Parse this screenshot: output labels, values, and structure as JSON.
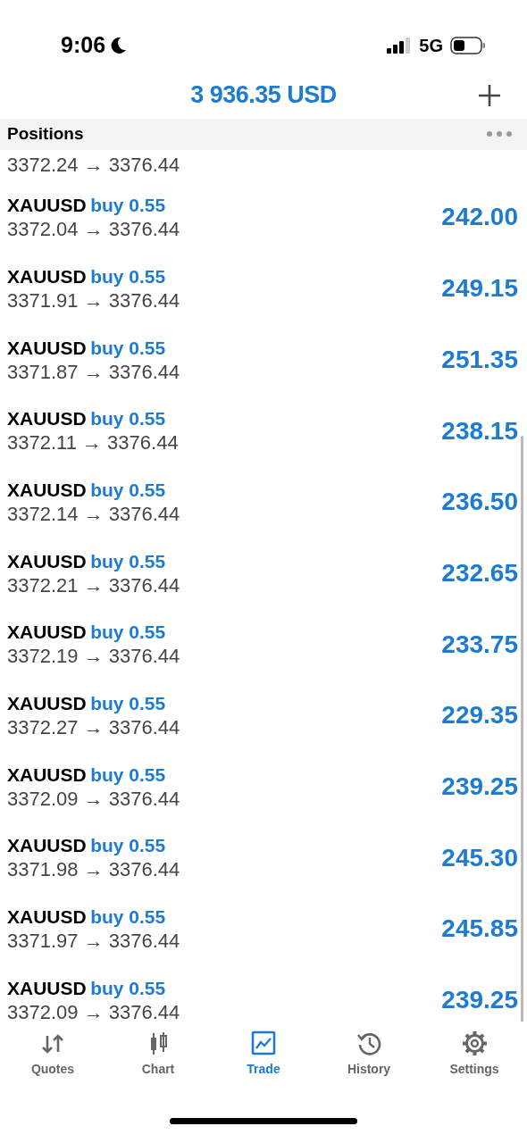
{
  "status_bar": {
    "time": "9:06",
    "network": "5G"
  },
  "header": {
    "balance": "3 936.35 USD"
  },
  "section": {
    "title": "Positions"
  },
  "partial_row": {
    "prices": "3372.24 → 3376.44"
  },
  "positions": [
    {
      "symbol": "XAUUSD",
      "side": "buy 0.55",
      "prices": "3372.04 → 3376.44",
      "profit": "242.00"
    },
    {
      "symbol": "XAUUSD",
      "side": "buy 0.55",
      "prices": "3371.91 → 3376.44",
      "profit": "249.15"
    },
    {
      "symbol": "XAUUSD",
      "side": "buy 0.55",
      "prices": "3371.87 → 3376.44",
      "profit": "251.35"
    },
    {
      "symbol": "XAUUSD",
      "side": "buy 0.55",
      "prices": "3372.11 → 3376.44",
      "profit": "238.15"
    },
    {
      "symbol": "XAUUSD",
      "side": "buy 0.55",
      "prices": "3372.14 → 3376.44",
      "profit": "236.50"
    },
    {
      "symbol": "XAUUSD",
      "side": "buy 0.55",
      "prices": "3372.21 → 3376.44",
      "profit": "232.65"
    },
    {
      "symbol": "XAUUSD",
      "side": "buy 0.55",
      "prices": "3372.19 → 3376.44",
      "profit": "233.75"
    },
    {
      "symbol": "XAUUSD",
      "side": "buy 0.55",
      "prices": "3372.27 → 3376.44",
      "profit": "229.35"
    },
    {
      "symbol": "XAUUSD",
      "side": "buy 0.55",
      "prices": "3372.09 → 3376.44",
      "profit": "239.25"
    },
    {
      "symbol": "XAUUSD",
      "side": "buy 0.55",
      "prices": "3371.98 → 3376.44",
      "profit": "245.30"
    },
    {
      "symbol": "XAUUSD",
      "side": "buy 0.55",
      "prices": "3371.97 → 3376.44",
      "profit": "245.85"
    },
    {
      "symbol": "XAUUSD",
      "side": "buy 0.55",
      "prices": "3372.09 → 3376.44",
      "profit": "239.25"
    }
  ],
  "tabs": [
    {
      "kind": "quotes",
      "label": "Quotes",
      "selected": false
    },
    {
      "kind": "chart",
      "label": "Chart",
      "selected": false
    },
    {
      "kind": "trade",
      "label": "Trade",
      "selected": true
    },
    {
      "kind": "history",
      "label": "History",
      "selected": false
    },
    {
      "kind": "settings",
      "label": "Settings",
      "selected": false
    }
  ]
}
